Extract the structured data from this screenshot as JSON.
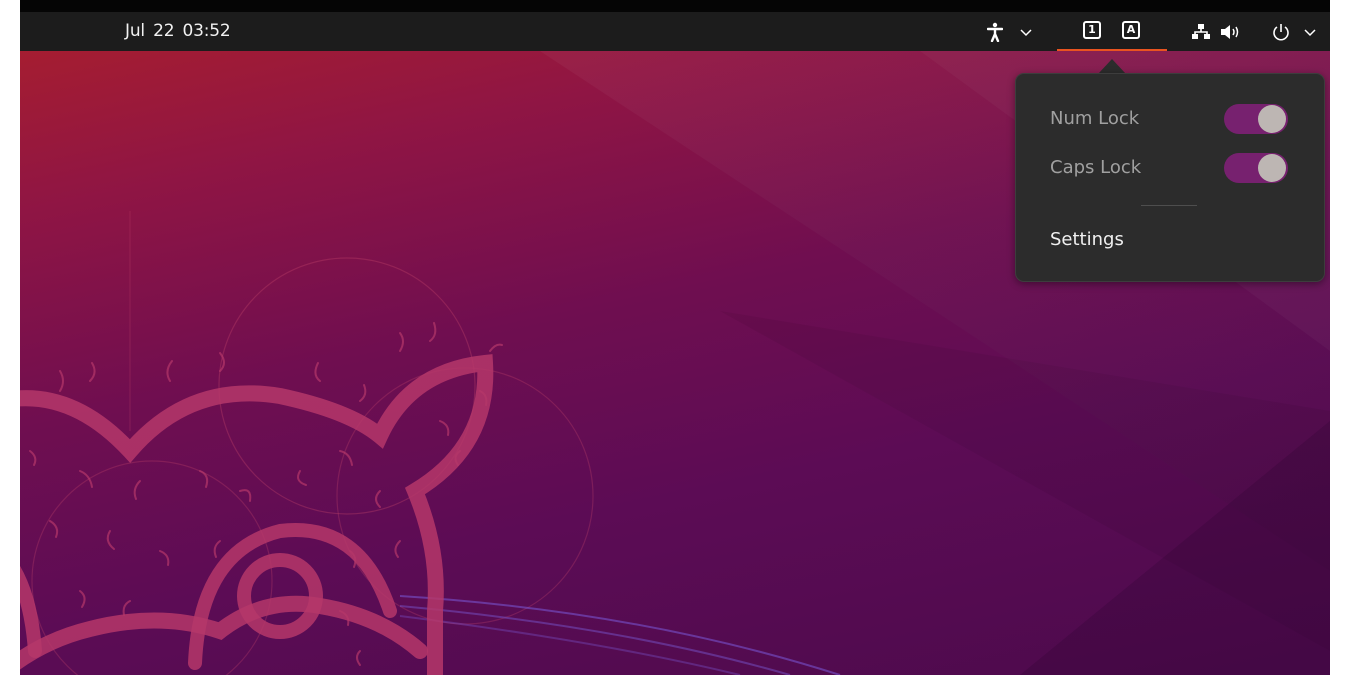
{
  "topbar": {
    "clock": "Jul 22  03:52",
    "icons": {
      "accessibility": "accessibility-icon",
      "accessibility_menu": "chevron-down-icon",
      "numlock_indicator": "1",
      "capslock_indicator": "A",
      "network": "network-icon",
      "volume": "volume-icon",
      "power": "power-icon",
      "system_menu": "chevron-down-icon"
    },
    "accent_color": "#e95420"
  },
  "keyboard_popup": {
    "items": [
      {
        "label": "Num Lock",
        "on": true
      },
      {
        "label": "Caps Lock",
        "on": true
      }
    ],
    "settings_label": "Settings",
    "toggle_color": "#77216f"
  }
}
